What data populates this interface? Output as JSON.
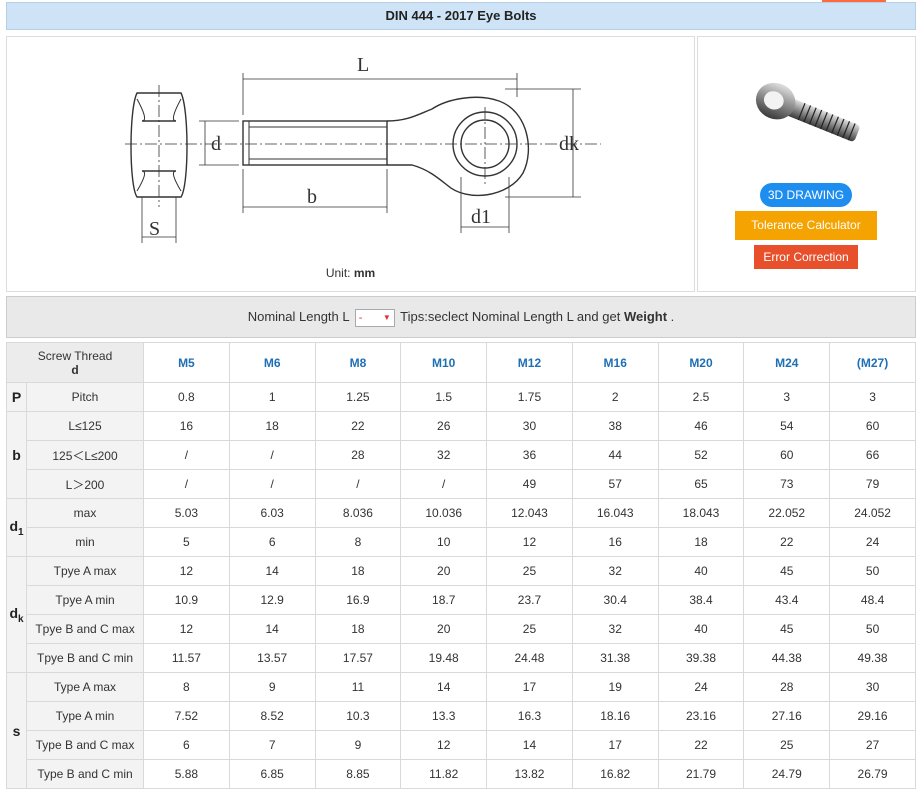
{
  "title": "DIN 444 - 2017 Eye Bolts",
  "drawing": {
    "labels": {
      "L": "L",
      "d": "d",
      "dk": "dk",
      "b": "b",
      "d1": "d1",
      "S": "S"
    },
    "unit_prefix": "Unit:",
    "unit_value": "mm"
  },
  "side": {
    "drawing_btn": "3D DRAWING",
    "tolerance_btn": "Tolerance Calculator",
    "error_btn": "Error Correction"
  },
  "filter": {
    "label": "Nominal Length L",
    "select_value": "-",
    "tip_prefix": "Tips:seclect Nominal Length L and get",
    "tip_bold": "Weight",
    "tip_suffix": "."
  },
  "table": {
    "corner_top": "Screw Thread",
    "corner_sym": "d",
    "sizes": [
      "M5",
      "M6",
      "M8",
      "M10",
      "M12",
      "M16",
      "M20",
      "M24",
      "(M27)"
    ],
    "groups": [
      {
        "symbol": "P",
        "sub": "",
        "rows": [
          {
            "label": "Pitch",
            "values": [
              "0.8",
              "1",
              "1.25",
              "1.5",
              "1.75",
              "2",
              "2.5",
              "3",
              "3"
            ]
          }
        ]
      },
      {
        "symbol": "b",
        "sub": "",
        "rows": [
          {
            "label": "L≤125",
            "values": [
              "16",
              "18",
              "22",
              "26",
              "30",
              "38",
              "46",
              "54",
              "60"
            ]
          },
          {
            "label": "125＜L≤200",
            "values": [
              "/",
              "/",
              "28",
              "32",
              "36",
              "44",
              "52",
              "60",
              "66"
            ]
          },
          {
            "label": "L＞200",
            "values": [
              "/",
              "/",
              "/",
              "/",
              "49",
              "57",
              "65",
              "73",
              "79"
            ]
          }
        ]
      },
      {
        "symbol": "d",
        "sub": "1",
        "rows": [
          {
            "label": "max",
            "values": [
              "5.03",
              "6.03",
              "8.036",
              "10.036",
              "12.043",
              "16.043",
              "18.043",
              "22.052",
              "24.052"
            ]
          },
          {
            "label": "min",
            "values": [
              "5",
              "6",
              "8",
              "10",
              "12",
              "16",
              "18",
              "22",
              "24"
            ]
          }
        ]
      },
      {
        "symbol": "d",
        "sub": "k",
        "rows": [
          {
            "label": "Tpye A max",
            "values": [
              "12",
              "14",
              "18",
              "20",
              "25",
              "32",
              "40",
              "45",
              "50"
            ]
          },
          {
            "label": "Tpye A min",
            "values": [
              "10.9",
              "12.9",
              "16.9",
              "18.7",
              "23.7",
              "30.4",
              "38.4",
              "43.4",
              "48.4"
            ]
          },
          {
            "label": "Tpye B and C max",
            "values": [
              "12",
              "14",
              "18",
              "20",
              "25",
              "32",
              "40",
              "45",
              "50"
            ]
          },
          {
            "label": "Tpye B and C min",
            "values": [
              "11.57",
              "13.57",
              "17.57",
              "19.48",
              "24.48",
              "31.38",
              "39.38",
              "44.38",
              "49.38"
            ]
          }
        ]
      },
      {
        "symbol": "s",
        "sub": "",
        "rows": [
          {
            "label": "Type A max",
            "values": [
              "8",
              "9",
              "11",
              "14",
              "17",
              "19",
              "24",
              "28",
              "30"
            ]
          },
          {
            "label": "Type A min",
            "values": [
              "7.52",
              "8.52",
              "10.3",
              "13.3",
              "16.3",
              "18.16",
              "23.16",
              "27.16",
              "29.16"
            ]
          },
          {
            "label": "Type B and C max",
            "values": [
              "6",
              "7",
              "9",
              "12",
              "14",
              "17",
              "22",
              "25",
              "27"
            ]
          },
          {
            "label": "Type B and C min",
            "values": [
              "5.88",
              "6.85",
              "8.85",
              "11.82",
              "13.82",
              "16.82",
              "21.79",
              "24.79",
              "26.79"
            ]
          }
        ]
      }
    ]
  },
  "colors": {
    "title_bg": "#cfe3f7",
    "size_header": "#1f6fb5",
    "btn_3d": "#1e8df0",
    "btn_tolerance": "#f5a300",
    "btn_error": "#e8502c"
  }
}
